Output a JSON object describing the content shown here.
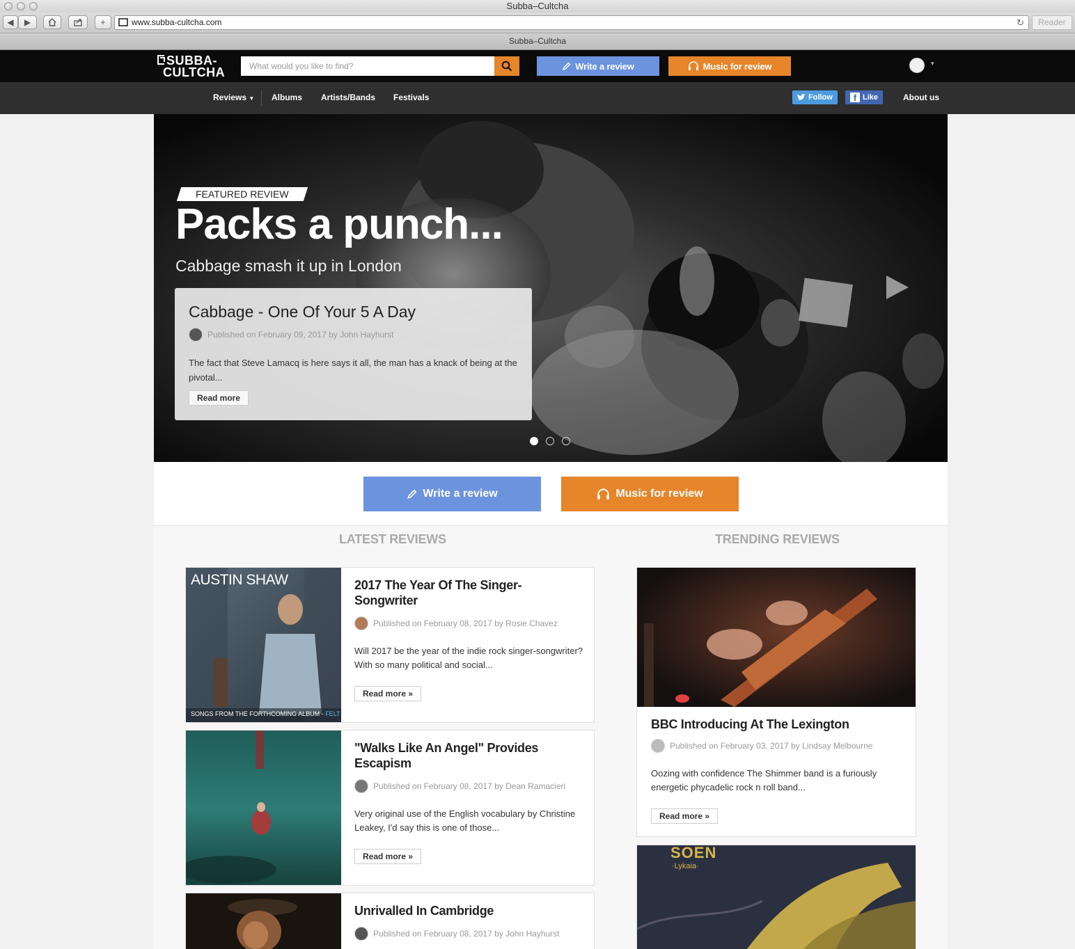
{
  "browser": {
    "window_title": "Subba–Cultcha",
    "url": "www.subba-cultcha.com",
    "reader_label": "Reader",
    "tab_title": "Subba–Cultcha"
  },
  "header": {
    "logo_line1": "SUBBA-",
    "logo_line2": "CULTCHA",
    "search_placeholder": "What would you like to find?",
    "write_review_label": "Write a review",
    "music_review_label": "Music for review"
  },
  "nav": {
    "items": [
      "Reviews",
      "Albums",
      "Artists/Bands",
      "Festivals"
    ],
    "follow_label": "Follow",
    "like_label": "Like",
    "about_label": "About us"
  },
  "hero": {
    "tag": "FEATURED REVIEW",
    "title": "Packs a punch...",
    "subtitle": "Cabbage smash it up in London",
    "card": {
      "title": "Cabbage - One Of Your 5 A Day",
      "meta": "Published on February 09, 2017 by John Hayhurst",
      "excerpt": "The fact that Steve Lamacq is here says it all, the man has a knack of being at the pivotal...",
      "read_more": "Read more"
    },
    "slides_total": 3,
    "slide_active": 1
  },
  "cta": {
    "write_review_label": "Write a review",
    "music_review_label": "Music for review"
  },
  "latest": {
    "title": "LATEST REVIEWS",
    "items": [
      {
        "title": "2017 The Year Of The Singer-Songwriter",
        "meta": "Published on February 08, 2017 by Rosie Chavez",
        "excerpt": "Will 2017 be the year of the indie rock singer-songwriter? With so many political and social...",
        "read_more": "Read more",
        "cover_text": "AUSTIN SHAW",
        "cover_caption": "SONGS FROM THE FORTHCOMING ALBUM - ",
        "cover_caption_accent": "FELT"
      },
      {
        "title": "\"Walks Like An Angel\" Provides Escapism",
        "meta": "Published on February 08, 2017 by Dean Ramacieri",
        "excerpt": "Very original use of the English vocabulary by Christine Leakey, I'd say this is one of those...",
        "read_more": "Read more"
      },
      {
        "title": "Unrivalled In Cambridge",
        "meta": "Published on February 08, 2017 by John Hayhurst"
      }
    ]
  },
  "trending": {
    "title": "TRENDING REVIEWS",
    "items": [
      {
        "title": "BBC Introducing At The Lexington",
        "meta": "Published on February 03, 2017 by Lindsay Melbourne",
        "excerpt": "Oozing with confidence The Shimmer band is a furiously energetic phycadelic rock n roll band...",
        "read_more": "Read more"
      },
      {
        "cover_text": "SOEN",
        "cover_sub": "·Lykaia·"
      }
    ]
  },
  "colors": {
    "accent_blue": "#6c93de",
    "accent_orange": "#e6852a",
    "header_bg": "#0b0b0b",
    "nav_bg": "#2f2f2f"
  }
}
